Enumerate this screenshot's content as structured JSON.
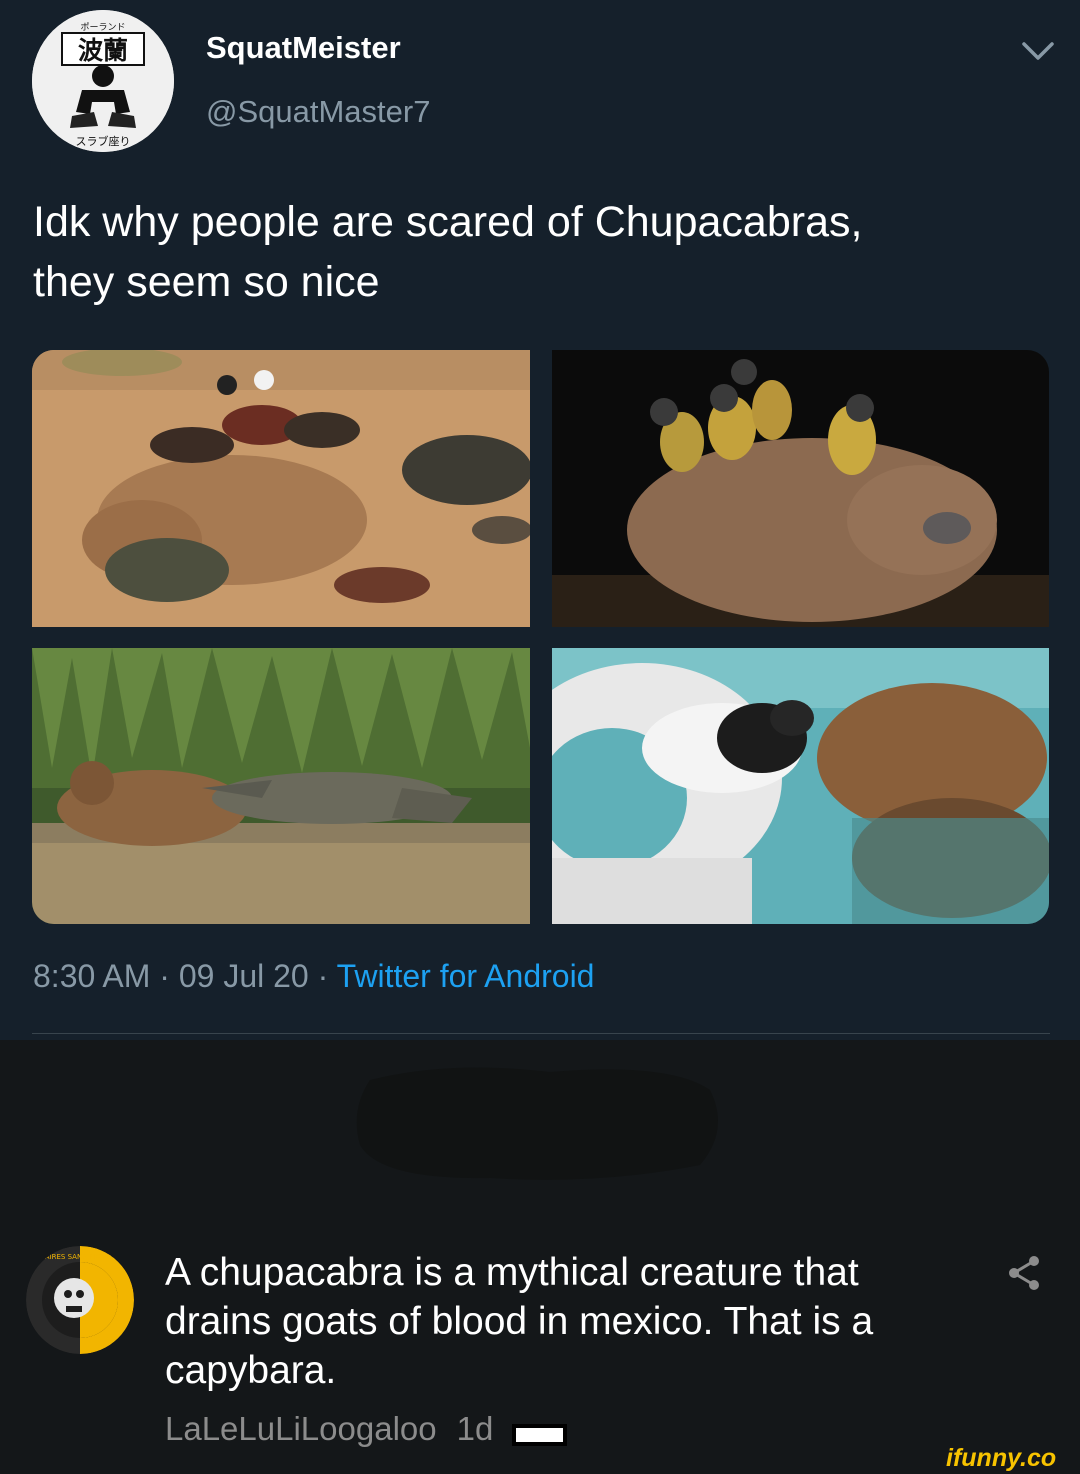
{
  "tweet": {
    "display_name": "SquatMeister",
    "handle": "@SquatMaster7",
    "text_line1": "Idk why people are scared of Chupacabras,",
    "text_line2": "they seem so nice",
    "time": "8:30 AM",
    "date": "09 Jul 20",
    "source": "Twitter for Android",
    "avatar_top_text": "ポーランド",
    "avatar_kanji": "波蘭",
    "avatar_bottom_text": "スラブ座り",
    "menu_icon": "chevron-down-icon"
  },
  "photos": [
    {
      "subject": "capybara-with-ducks-and-turtles"
    },
    {
      "subject": "capybara-with-squirrel-monkeys"
    },
    {
      "subject": "capybara-with-caiman"
    },
    {
      "subject": "capybara-with-rat-in-pool"
    }
  ],
  "comment": {
    "line1": "A chupacabra is a mythical creature that",
    "line2": "drains goats of blood in mexico. That is a",
    "line3": "capybara.",
    "username": "LaLeLuLiLoogaloo",
    "time_ago": "1d",
    "avatar_ring_text": "MILITAIRES SANS FRONTIERES",
    "share_icon": "share-icon"
  },
  "watermark": "ifunny.co",
  "colors": {
    "background": "#15202b",
    "secondary_text": "#8899a6",
    "link": "#1da1f2",
    "watermark": "#f7c300"
  }
}
